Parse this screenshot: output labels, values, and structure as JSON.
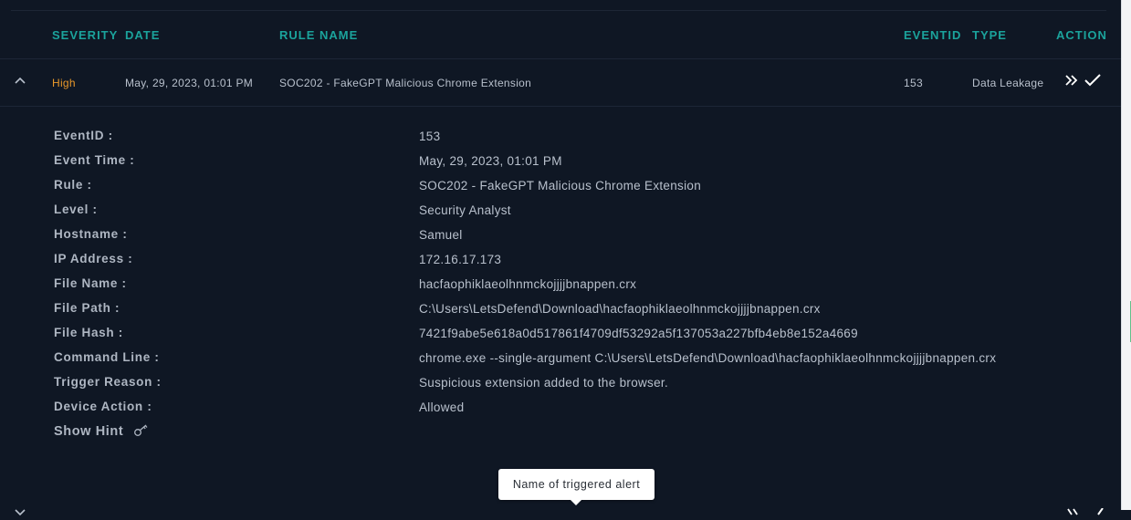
{
  "table": {
    "headers": {
      "severity": "SEVERITY",
      "date": "DATE",
      "rule_name": "RULE NAME",
      "eventid": "EVENTID",
      "type": "TYPE",
      "action": "ACTION"
    },
    "row": {
      "severity": "High",
      "date": "May, 29, 2023, 01:01 PM",
      "rule_name": "SOC202 - FakeGPT Malicious Chrome Extension",
      "eventid": "153",
      "type": "Data Leakage",
      "severity_color": "#e9982a"
    }
  },
  "details": [
    {
      "label": "EventID :",
      "value": "153"
    },
    {
      "label": "Event Time :",
      "value": "May, 29, 2023, 01:01 PM"
    },
    {
      "label": "Rule :",
      "value": "SOC202 - FakeGPT Malicious Chrome Extension"
    },
    {
      "label": "Level :",
      "value": "Security Analyst"
    },
    {
      "label": "Hostname :",
      "value": "Samuel"
    },
    {
      "label": "IP Address :",
      "value": "172.16.17.173"
    },
    {
      "label": "File Name :",
      "value": "hacfaophiklaeolhnmckojjjjbnappen.crx"
    },
    {
      "label": "File Path :",
      "value": "C:\\Users\\LetsDefend\\Download\\hacfaophiklaeolhnmckojjjjbnappen.crx"
    },
    {
      "label": "File Hash :",
      "value": "7421f9abe5e618a0d517861f4709df53292a5f137053a227bfb4eb8e152a4669"
    },
    {
      "label": "Command Line :",
      "value": "chrome.exe --single-argument C:\\Users\\LetsDefend\\Download\\hacfaophiklaeolhnmckojjjjbnappen.crx"
    },
    {
      "label": "Trigger Reason :",
      "value": "Suspicious extension added to the browser."
    },
    {
      "label": "Device Action :",
      "value": "Allowed"
    }
  ],
  "show_hint": {
    "label": "Show Hint",
    "icon": "key-icon"
  },
  "tooltip": {
    "text": "Name of triggered alert"
  },
  "colors": {
    "background": "#0f1724",
    "accent_teal": "#1ba39c",
    "severity_high": "#e9982a",
    "text": "#b8c0cc"
  },
  "icons": {
    "collapse": "chevron-up-icon",
    "escalate": "double-chevron-right-icon",
    "close": "checkmark-icon"
  }
}
